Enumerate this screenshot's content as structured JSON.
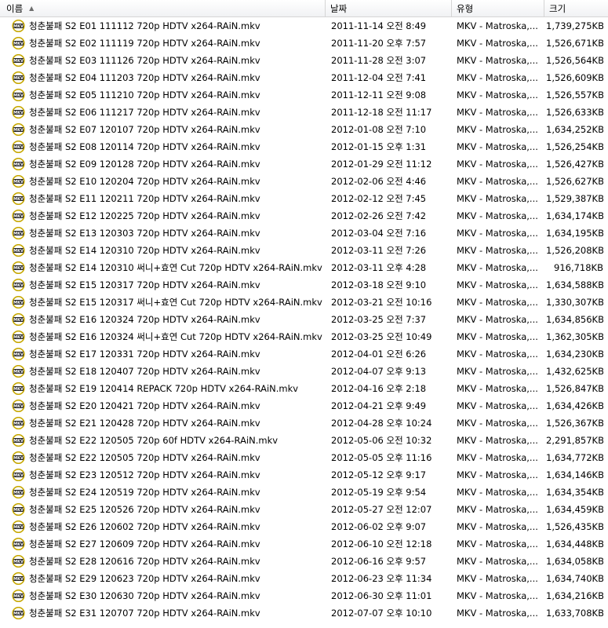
{
  "header": {
    "name_label": "이름",
    "date_label": "날짜",
    "type_label": "유형",
    "size_label": "크기"
  },
  "icon": {
    "name": "mkv-file-icon",
    "colors": {
      "ring": "#c6a700",
      "badge": "#222222",
      "text": "#ffffff"
    },
    "badge_text": "MKV"
  },
  "files": [
    {
      "name": "청춘불패 S2 E01 111112 720p HDTV x264-RAiN.mkv",
      "date": "2011-11-14 오전 8:49",
      "type": "MKV - Matroska,...",
      "size": "1,739,275KB"
    },
    {
      "name": "청춘불패 S2 E02 111119 720p HDTV x264-RAiN.mkv",
      "date": "2011-11-20 오후 7:57",
      "type": "MKV - Matroska,...",
      "size": "1,526,671KB"
    },
    {
      "name": "청춘불패 S2 E03 111126 720p HDTV x264-RAiN.mkv",
      "date": "2011-11-28 오전 3:07",
      "type": "MKV - Matroska,...",
      "size": "1,526,564KB"
    },
    {
      "name": "청춘불패 S2 E04 111203 720p HDTV x264-RAiN.mkv",
      "date": "2011-12-04 오전 7:41",
      "type": "MKV - Matroska,...",
      "size": "1,526,609KB"
    },
    {
      "name": "청춘불패 S2 E05 111210 720p HDTV x264-RAiN.mkv",
      "date": "2011-12-11 오전 9:08",
      "type": "MKV - Matroska,...",
      "size": "1,526,557KB"
    },
    {
      "name": "청춘불패 S2 E06 111217 720p HDTV x264-RAiN.mkv",
      "date": "2011-12-18 오전 11:17",
      "type": "MKV - Matroska,...",
      "size": "1,526,633KB"
    },
    {
      "name": "청춘불패 S2 E07 120107 720p HDTV x264-RAiN.mkv",
      "date": "2012-01-08 오전 7:10",
      "type": "MKV - Matroska,...",
      "size": "1,634,252KB"
    },
    {
      "name": "청춘불패 S2 E08 120114 720p HDTV x264-RAiN.mkv",
      "date": "2012-01-15 오후 1:31",
      "type": "MKV - Matroska,...",
      "size": "1,526,254KB"
    },
    {
      "name": "청춘불패 S2 E09 120128 720p HDTV x264-RAiN.mkv",
      "date": "2012-01-29 오전 11:12",
      "type": "MKV - Matroska,...",
      "size": "1,526,427KB"
    },
    {
      "name": "청춘불패 S2 E10 120204 720p HDTV x264-RAiN.mkv",
      "date": "2012-02-06 오전 4:46",
      "type": "MKV - Matroska,...",
      "size": "1,526,627KB"
    },
    {
      "name": "청춘불패 S2 E11 120211 720p HDTV x264-RAiN.mkv",
      "date": "2012-02-12 오전 7:45",
      "type": "MKV - Matroska,...",
      "size": "1,529,387KB"
    },
    {
      "name": "청춘불패 S2 E12 120225 720p HDTV x264-RAiN.mkv",
      "date": "2012-02-26 오전 7:42",
      "type": "MKV - Matroska,...",
      "size": "1,634,174KB"
    },
    {
      "name": "청춘불패 S2 E13 120303 720p HDTV x264-RAiN.mkv",
      "date": "2012-03-04 오전 7:16",
      "type": "MKV - Matroska,...",
      "size": "1,634,195KB"
    },
    {
      "name": "청춘불패 S2 E14 120310 720p HDTV x264-RAiN.mkv",
      "date": "2012-03-11 오전 7:26",
      "type": "MKV - Matroska,...",
      "size": "1,526,208KB"
    },
    {
      "name": "청춘불패 S2 E14 120310 써니+효연 Cut 720p HDTV x264-RAiN.mkv",
      "date": "2012-03-11 오후 4:28",
      "type": "MKV - Matroska,...",
      "size": "916,718KB"
    },
    {
      "name": "청춘불패 S2 E15 120317 720p HDTV x264-RAiN.mkv",
      "date": "2012-03-18 오전 9:10",
      "type": "MKV - Matroska,...",
      "size": "1,634,588KB"
    },
    {
      "name": "청춘불패 S2 E15 120317 써니+효연 Cut 720p HDTV x264-RAiN.mkv",
      "date": "2012-03-21 오전 10:16",
      "type": "MKV - Matroska,...",
      "size": "1,330,307KB"
    },
    {
      "name": "청춘불패 S2 E16 120324 720p HDTV x264-RAiN.mkv",
      "date": "2012-03-25 오전 7:37",
      "type": "MKV - Matroska,...",
      "size": "1,634,856KB"
    },
    {
      "name": "청춘불패 S2 E16 120324 써니+효연 Cut 720p HDTV x264-RAiN.mkv",
      "date": "2012-03-25 오전 10:49",
      "type": "MKV - Matroska,...",
      "size": "1,362,305KB"
    },
    {
      "name": "청춘불패 S2 E17 120331 720p HDTV x264-RAiN.mkv",
      "date": "2012-04-01 오전 6:26",
      "type": "MKV - Matroska,...",
      "size": "1,634,230KB"
    },
    {
      "name": "청춘불패 S2 E18 120407 720p HDTV x264-RAiN.mkv",
      "date": "2012-04-07 오후 9:13",
      "type": "MKV - Matroska,...",
      "size": "1,432,625KB"
    },
    {
      "name": "청춘불패 S2 E19 120414 REPACK 720p HDTV x264-RAiN.mkv",
      "date": "2012-04-16 오후 2:18",
      "type": "MKV - Matroska,...",
      "size": "1,526,847KB"
    },
    {
      "name": "청춘불패 S2 E20 120421 720p HDTV x264-RAiN.mkv",
      "date": "2012-04-21 오후 9:49",
      "type": "MKV - Matroska,...",
      "size": "1,634,426KB"
    },
    {
      "name": "청춘불패 S2 E21 120428 720p HDTV x264-RAiN.mkv",
      "date": "2012-04-28 오후 10:24",
      "type": "MKV - Matroska,...",
      "size": "1,526,367KB"
    },
    {
      "name": "청춘불패 S2 E22 120505 720p 60f HDTV x264-RAiN.mkv",
      "date": "2012-05-06 오전 10:32",
      "type": "MKV - Matroska,...",
      "size": "2,291,857KB"
    },
    {
      "name": "청춘불패 S2 E22 120505 720p HDTV x264-RAiN.mkv",
      "date": "2012-05-05 오후 11:16",
      "type": "MKV - Matroska,...",
      "size": "1,634,772KB"
    },
    {
      "name": "청춘불패 S2 E23 120512 720p HDTV x264-RAiN.mkv",
      "date": "2012-05-12 오후 9:17",
      "type": "MKV - Matroska,...",
      "size": "1,634,146KB"
    },
    {
      "name": "청춘불패 S2 E24 120519 720p HDTV x264-RAiN.mkv",
      "date": "2012-05-19 오후 9:54",
      "type": "MKV - Matroska,...",
      "size": "1,634,354KB"
    },
    {
      "name": "청춘불패 S2 E25 120526 720p HDTV x264-RAiN.mkv",
      "date": "2012-05-27 오전 12:07",
      "type": "MKV - Matroska,...",
      "size": "1,634,459KB"
    },
    {
      "name": "청춘불패 S2 E26 120602 720p HDTV x264-RAiN.mkv",
      "date": "2012-06-02 오후 9:07",
      "type": "MKV - Matroska,...",
      "size": "1,526,435KB"
    },
    {
      "name": "청춘불패 S2 E27 120609 720p HDTV x264-RAiN.mkv",
      "date": "2012-06-10 오전 12:18",
      "type": "MKV - Matroska,...",
      "size": "1,634,448KB"
    },
    {
      "name": "청춘불패 S2 E28 120616 720p HDTV x264-RAiN.mkv",
      "date": "2012-06-16 오후 9:57",
      "type": "MKV - Matroska,...",
      "size": "1,634,058KB"
    },
    {
      "name": "청춘불패 S2 E29 120623 720p HDTV x264-RAiN.mkv",
      "date": "2012-06-23 오후 11:34",
      "type": "MKV - Matroska,...",
      "size": "1,634,740KB"
    },
    {
      "name": "청춘불패 S2 E30 120630 720p HDTV x264-RAiN.mkv",
      "date": "2012-06-30 오후 11:01",
      "type": "MKV - Matroska,...",
      "size": "1,634,216KB"
    },
    {
      "name": "청춘불패 S2 E31 120707 720p HDTV x264-RAiN.mkv",
      "date": "2012-07-07 오후 10:10",
      "type": "MKV - Matroska,...",
      "size": "1,633,708KB"
    }
  ]
}
